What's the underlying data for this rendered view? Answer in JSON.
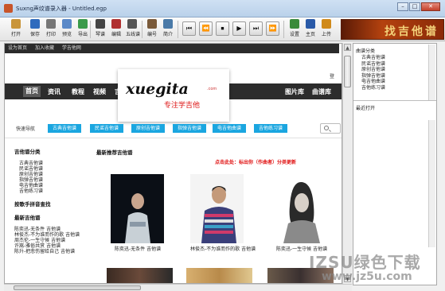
{
  "window": {
    "title": "Suxng声纹谱录入器 - Untitled.egp",
    "min": "–",
    "max": "□",
    "close": "✕"
  },
  "toolbar": {
    "items": [
      {
        "label": "打开",
        "color": "#c9953a"
      },
      {
        "label": "保存",
        "color": "#2f6bbd"
      },
      {
        "label": "打印",
        "color": "#777777"
      },
      {
        "label": "预览",
        "color": "#5b89c8"
      },
      {
        "label": "导出",
        "color": "#3a9a4a"
      },
      {
        "label": "琴谱",
        "color": "#444444"
      },
      {
        "label": "编辑",
        "color": "#b03030"
      },
      {
        "label": "五线谱",
        "color": "#555555"
      },
      {
        "label": "编号",
        "color": "#7a5a3a"
      },
      {
        "label": "简介",
        "color": "#4a7aa8"
      },
      {
        "label": "设置",
        "color": "#3a8a3a"
      },
      {
        "label": "主页",
        "color": "#2a5aa8"
      },
      {
        "label": "上传",
        "color": "#d08a1a"
      }
    ],
    "media": [
      "⏮",
      "⏪",
      "⏹",
      "▶",
      "⏭",
      "⏩"
    ],
    "banner_text": "找吉他谱"
  },
  "browser": {
    "topbar": [
      "设为首页",
      "加入收藏",
      "学吉他网"
    ],
    "logo": "xuegita",
    "logo_com": ".com",
    "slogan": "专注学吉他",
    "right_text": "登",
    "menu": [
      "首页",
      "资讯",
      "教程",
      "视频",
      "吉",
      "图片库",
      "曲谱库"
    ],
    "tag_label": "快速导航",
    "tags": [
      "古典吉他谱",
      "民谣吉他谱",
      "原创吉他谱",
      "指弹吉他谱",
      "电吉他曲谱",
      "吉他练习谱"
    ],
    "left_col": {
      "h1": "吉他谱分类",
      "items1": [
        "古典吉他谱",
        "民谣吉他谱",
        "原创吉他谱",
        "指弹吉他谱",
        "电吉他曲谱",
        "吉他练习谱"
      ],
      "h2": "按歌手拼音查找",
      "h3": "最新吉他谱",
      "items3": [
        "陈奕迅-无条件 吉他谱",
        "林俊杰-不为谁而作的歌 吉他谱",
        "周杰伦-一生守候 吉他谱",
        "许嵩-雅俗共赏 吉他谱",
        "陈升-把悲伤留给自己 吉他谱"
      ]
    },
    "section_title": "最新推荐吉他谱",
    "red_text": "点击此处：标出你（作曲者）分类更新",
    "photos": [
      {
        "caption": "陈奕迅-无条件 吉他谱"
      },
      {
        "caption": "林俊杰-不为谁而作的歌 吉他谱"
      },
      {
        "caption": "陈奕迅-一生守候 吉他谱"
      }
    ]
  },
  "right_panel": {
    "header": "曲谱分类",
    "items": [
      "古典吉他谱",
      "民谣吉他谱",
      "原创吉他谱",
      "指弹吉他谱",
      "电吉他曲谱",
      "吉他练习谱"
    ],
    "header2": "最近打开"
  },
  "watermark": {
    "line1": "IZSU绿色下载",
    "line2": "www.jz5u.com"
  }
}
